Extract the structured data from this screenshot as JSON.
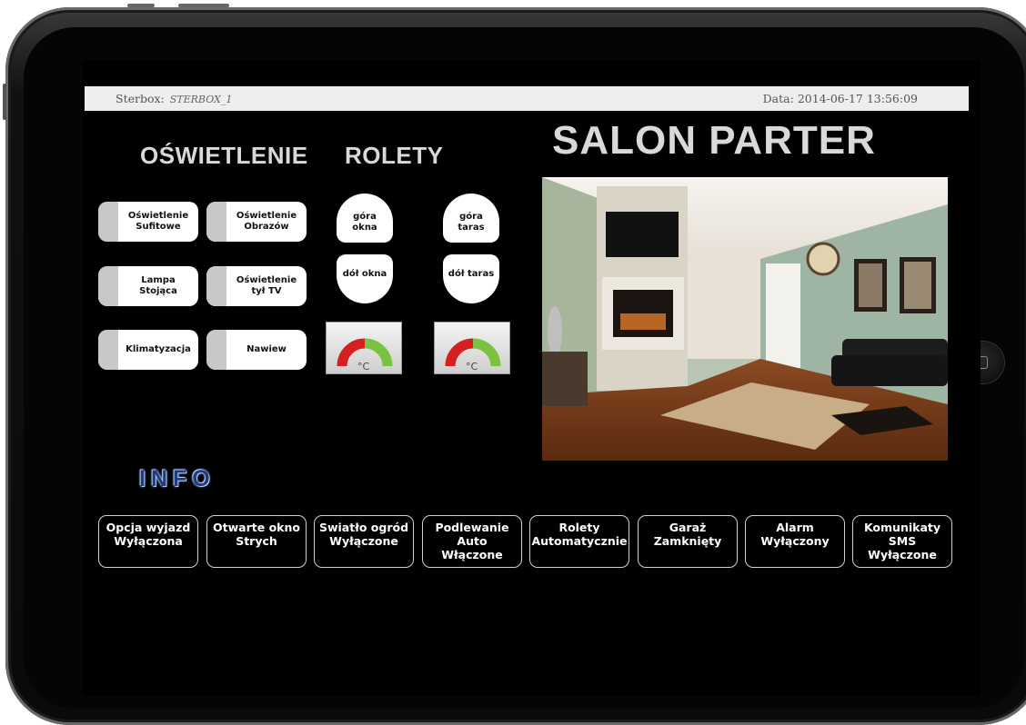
{
  "status_bar": {
    "sterbox_label": "Sterbox:",
    "sterbox_value": "STERBOX_1",
    "date_label": "Data:",
    "date_value": "2014-06-17 13:56:09"
  },
  "headings": {
    "lighting": "OŚWIETLENIE",
    "blinds": "ROLETY",
    "room": "SALON PARTER",
    "info": "INFO"
  },
  "lighting_buttons": [
    {
      "label": "Oświetlenie\nSufitowe"
    },
    {
      "label": "Oświetlenie\nObrazów"
    },
    {
      "label": "Lampa\nStojąca"
    },
    {
      "label": "Oświetlenie\ntył TV"
    },
    {
      "label": "Klimatyzacja"
    },
    {
      "label": "Nawiew"
    }
  ],
  "blind_buttons": {
    "window_up": "góra\nokna",
    "window_down": "dół okna",
    "terrace_up": "góra\ntaras",
    "terrace_down": "dół taras"
  },
  "gauges": [
    {
      "unit": "°C",
      "colors": [
        "#d42020",
        "#7cc242"
      ]
    },
    {
      "unit": "°C",
      "colors": [
        "#d42020",
        "#7cc242"
      ]
    }
  ],
  "info_buttons": [
    {
      "label": "Opcja wyjazd\nWyłączona"
    },
    {
      "label": "Otwarte okno\nStrych"
    },
    {
      "label": "Swiatło ogród\nWyłączone"
    },
    {
      "label": "Podlewanie\nAuto\nWłączone"
    },
    {
      "label": "Rolety\nAutomatycznie"
    },
    {
      "label": "Garaż\nZamknięty"
    },
    {
      "label": "Alarm\nWyłączony"
    },
    {
      "label": "Komunikaty\nSMS\nWyłączone"
    }
  ],
  "colors": {
    "screen_bg": "#000000",
    "heading": "#d9d9d9",
    "info_heading": "#1f3d7a"
  }
}
